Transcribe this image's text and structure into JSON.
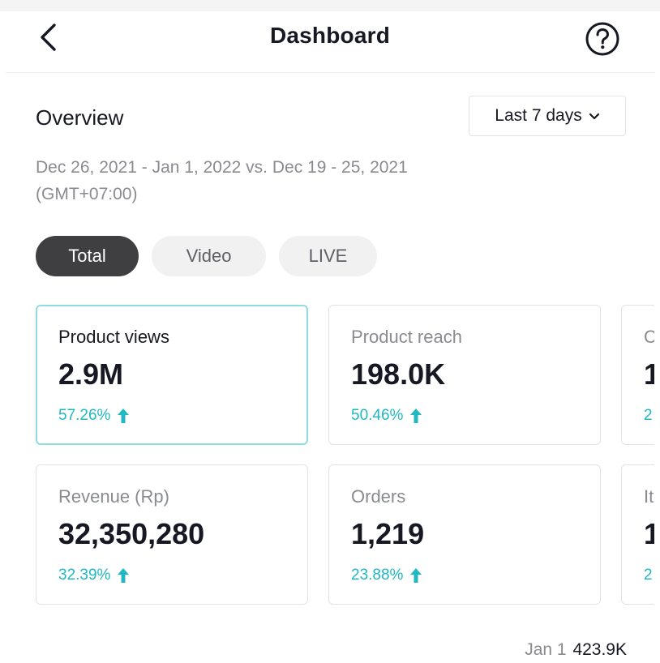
{
  "header": {
    "title": "Dashboard",
    "back_icon": "chevron-left-icon",
    "help_icon": "question-circle-icon"
  },
  "overview": {
    "title": "Overview",
    "range_select": {
      "selected": "Last 7 days",
      "icon": "chevron-down-icon"
    },
    "date_range_line1": "Dec 26, 2021 - Jan 1, 2022 vs. Dec 19 - 25, 2021",
    "date_range_line2": "(GMT+07:00)"
  },
  "tabs": [
    {
      "label": "Total",
      "active": true
    },
    {
      "label": "Video",
      "active": false
    },
    {
      "label": "LIVE",
      "active": false
    }
  ],
  "metrics": [
    {
      "label": "Product views",
      "value": "2.9M",
      "change": "57.26%",
      "trend": "up",
      "selected": true
    },
    {
      "label": "Product reach",
      "value": "198.0K",
      "change": "50.46%",
      "trend": "up",
      "selected": false
    },
    {
      "label": "C",
      "value": "1",
      "change": "2",
      "trend": "up",
      "selected": false
    },
    {
      "label": "Revenue (Rp)",
      "value": "32,350,280",
      "change": "32.39%",
      "trend": "up",
      "selected": false
    },
    {
      "label": "Orders",
      "value": "1,219",
      "change": "23.88%",
      "trend": "up",
      "selected": false
    },
    {
      "label": "It",
      "value": "1",
      "change": "2",
      "trend": "up",
      "selected": false
    }
  ],
  "chart_readout": {
    "date": "Jan 1",
    "value": "423.9K"
  },
  "colors": {
    "accent": "#1fb8c3",
    "selected_border": "#8fdde0",
    "active_tab": "#3f3f41",
    "inactive_tab": "#f1f1f2",
    "muted_text": "#8a8b91"
  }
}
